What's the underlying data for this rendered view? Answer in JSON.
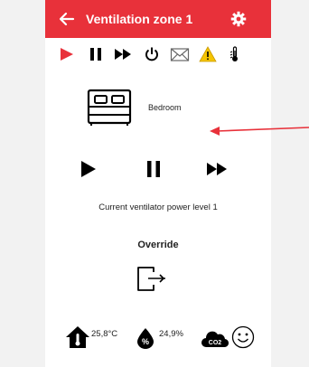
{
  "header": {
    "title": "Ventilation zone 1",
    "back_icon": "arrow-left-icon",
    "settings_icon": "gear-icon"
  },
  "toolbar": {
    "items": [
      {
        "name": "play",
        "icon": "play-icon",
        "color": "#e8313a"
      },
      {
        "name": "pause",
        "icon": "pause-icon"
      },
      {
        "name": "fast-forward",
        "icon": "fast-forward-icon"
      },
      {
        "name": "power",
        "icon": "power-icon"
      },
      {
        "name": "mail",
        "icon": "envelope-icon"
      },
      {
        "name": "warning",
        "icon": "warning-icon",
        "color": "#f5c400"
      },
      {
        "name": "temperature",
        "icon": "thermometer-hand-icon"
      }
    ]
  },
  "room": {
    "label": "Bedroom",
    "icon": "bed-icon"
  },
  "controls": [
    "play-icon",
    "pause-icon",
    "fast-forward-icon"
  ],
  "status_text": "Current ventilator power level 1",
  "override": {
    "label": "Override",
    "icon": "override-exit-icon"
  },
  "sensors": {
    "temperature": "25,8°C",
    "humidity": "24,9%",
    "co2_label": "CO2",
    "mood_icon": "smiley-icon"
  },
  "colors": {
    "accent": "#e8313a",
    "warning": "#f5c400"
  }
}
